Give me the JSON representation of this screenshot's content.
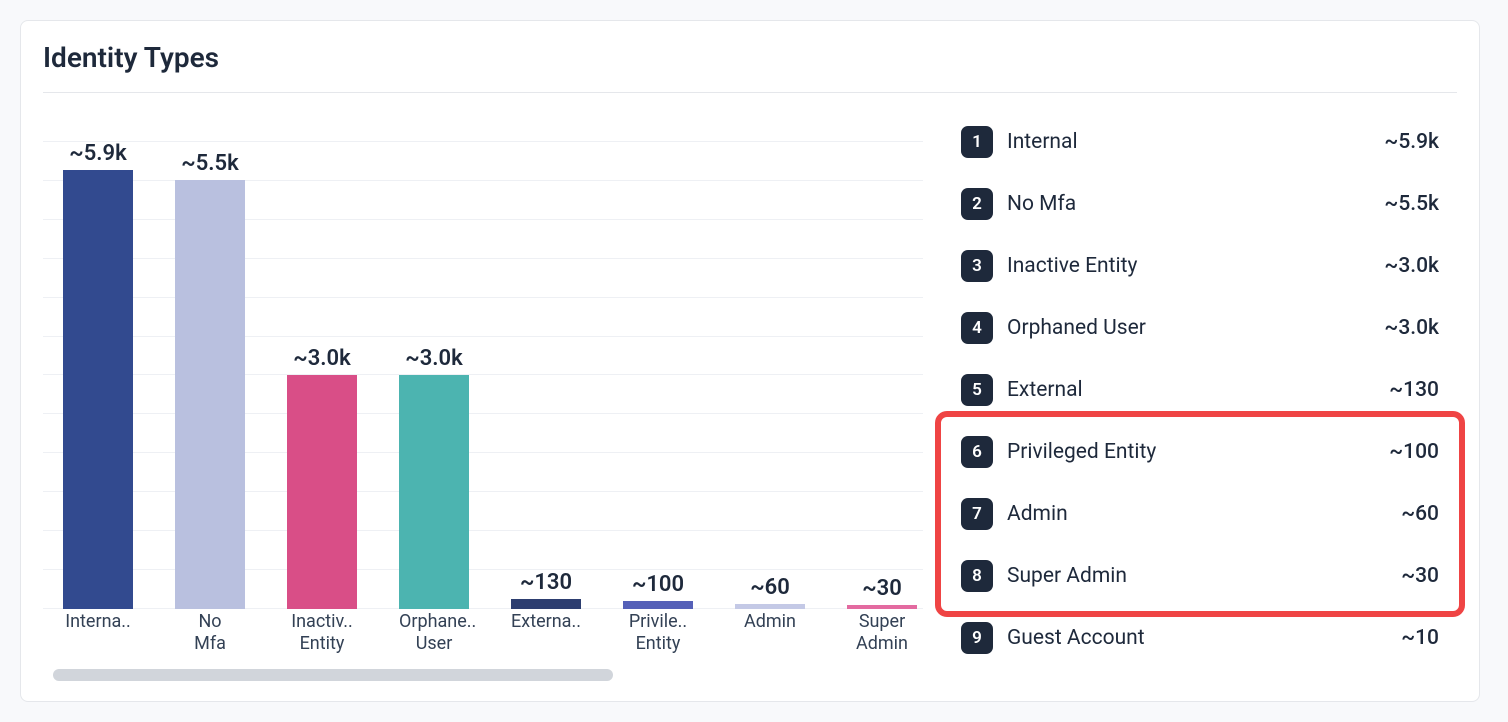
{
  "title": "Identity Types",
  "chart_data": {
    "type": "bar",
    "title": "Identity Types",
    "xlabel": "",
    "ylabel": "",
    "ylim": [
      0,
      6000
    ],
    "categories": [
      "Internal",
      "No Mfa",
      "Inactive Entity",
      "Orphaned User",
      "External",
      "Privileged Entity",
      "Admin",
      "Super Admin"
    ],
    "values": [
      5900,
      5500,
      3000,
      3000,
      130,
      100,
      60,
      30
    ],
    "display_values": [
      "~5.9k",
      "~5.5k",
      "~3.0k",
      "~3.0k",
      "~130",
      "~100",
      "~60",
      "~30"
    ],
    "display_labels": [
      "Interna..",
      "No\nMfa",
      "Inactiv..\nEntity",
      "Orphane..\nUser",
      "Externa..",
      "Privile..\nEntity",
      "Admin",
      "Super\nAdmin"
    ],
    "colors": [
      "#324a8f",
      "#b9c0df",
      "#d94e87",
      "#4cb4b0",
      "#2d3e70",
      "#5560b8",
      "#c4c9e6",
      "#e36aa0"
    ]
  },
  "list": [
    {
      "rank": "1",
      "label": "Internal",
      "value": "~5.9k"
    },
    {
      "rank": "2",
      "label": "No Mfa",
      "value": "~5.5k"
    },
    {
      "rank": "3",
      "label": "Inactive Entity",
      "value": "~3.0k"
    },
    {
      "rank": "4",
      "label": "Orphaned User",
      "value": "~3.0k"
    },
    {
      "rank": "5",
      "label": "External",
      "value": "~130"
    },
    {
      "rank": "6",
      "label": "Privileged Entity",
      "value": "~100"
    },
    {
      "rank": "7",
      "label": "Admin",
      "value": "~60"
    },
    {
      "rank": "8",
      "label": "Super Admin",
      "value": "~30"
    },
    {
      "rank": "9",
      "label": "Guest Account",
      "value": "~10"
    }
  ],
  "highlight": {
    "start_index": 5,
    "end_index": 7
  }
}
